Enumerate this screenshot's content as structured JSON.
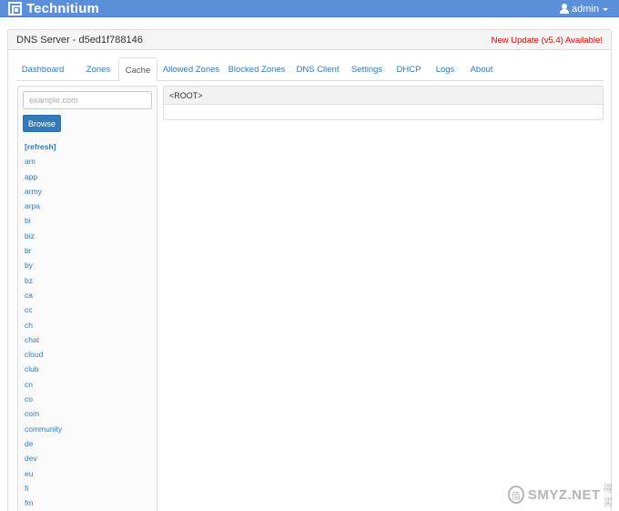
{
  "navbar": {
    "brand": "Technitium",
    "user": "admin",
    "bg_color": "#5b8fd9"
  },
  "panel": {
    "title": "DNS Server - d5ed1f788146",
    "update_notice": "New Update (v5.4) Available!",
    "update_color": "#e00000"
  },
  "tabs": [
    "Dashboard",
    "Zones",
    "Cache",
    "Allowed Zones",
    "Blocked Zones",
    "DNS Client",
    "Settings",
    "DHCP",
    "Logs",
    "About"
  ],
  "active_tab": "Cache",
  "cache": {
    "domain_placeholder": "example.com",
    "browse_label": "Browse",
    "refresh_label": "[refresh]",
    "zones": [
      "am",
      "app",
      "army",
      "arpa",
      "bi",
      "biz",
      "br",
      "by",
      "bz",
      "ca",
      "cc",
      "ch",
      "chat",
      "cloud",
      "club",
      "cn",
      "co",
      "com",
      "community",
      "de",
      "dev",
      "eu",
      "fi",
      "fm"
    ],
    "current_zone": "<ROOT>"
  },
  "watermark": {
    "seal": "值",
    "text": "SMYZ.NET",
    "sub": "得买"
  }
}
